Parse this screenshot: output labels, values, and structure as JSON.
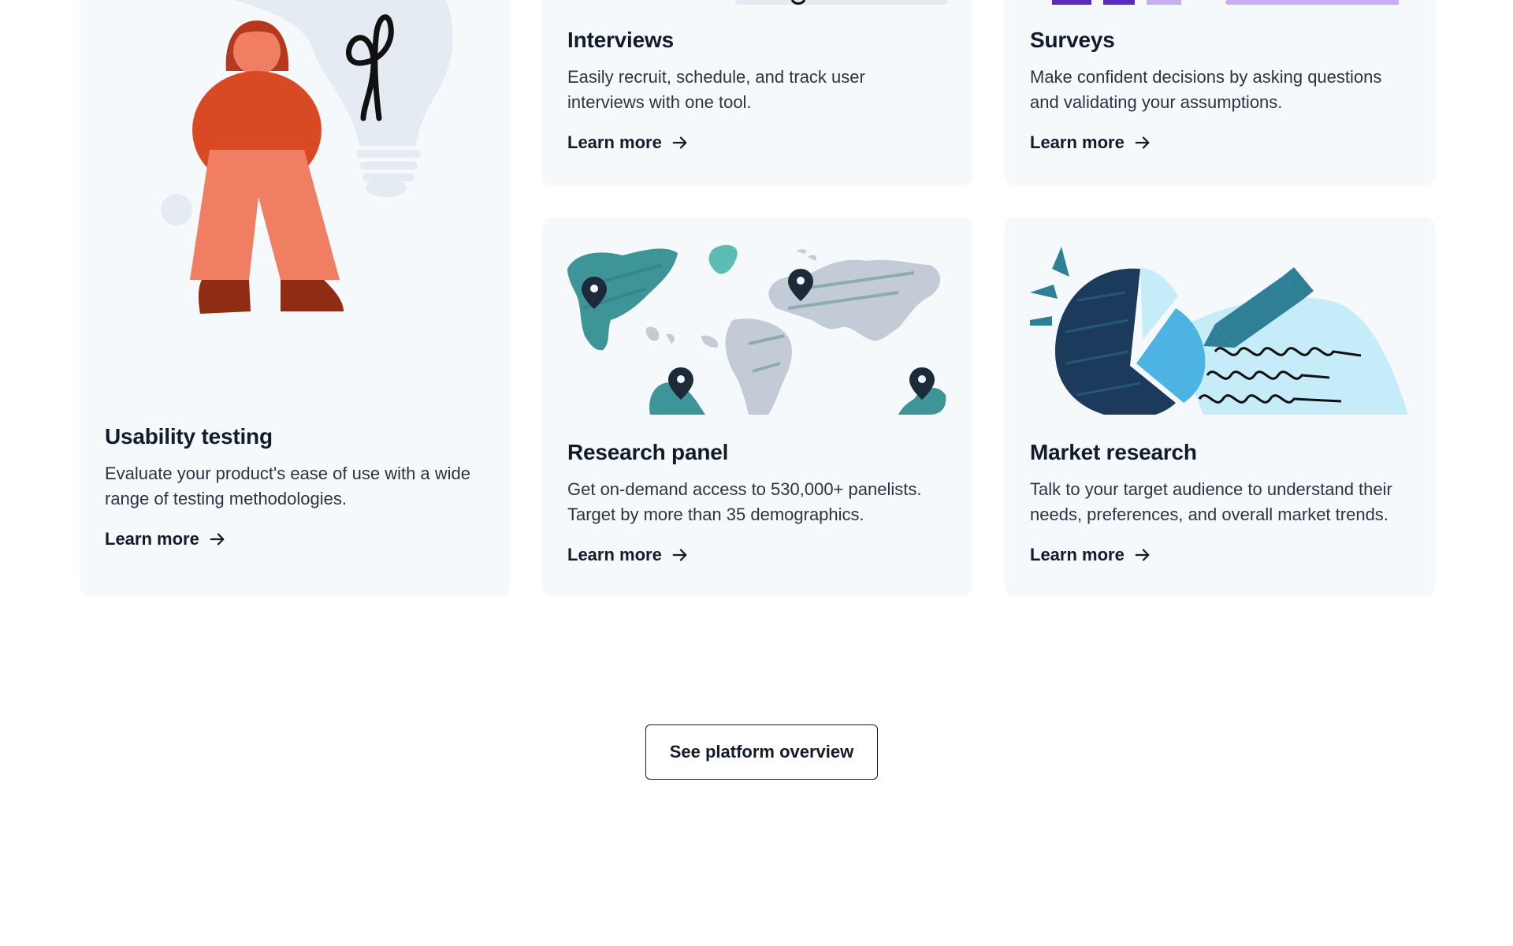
{
  "cards": {
    "usability": {
      "title": "Usability testing",
      "description": "Evaluate your product's ease of use with a wide range of testing methodologies.",
      "link": "Learn more",
      "illustration": "person-with-lightbulb-illustration"
    },
    "interviews": {
      "title": "Interviews",
      "description": "Easily recruit, schedule, and track user interviews with one tool.",
      "link": "Learn more"
    },
    "surveys": {
      "title": "Surveys",
      "description": "Make confident decisions by asking questions and validating your assumptions.",
      "link": "Learn more"
    },
    "panel": {
      "title": "Research panel",
      "description": "Get on-demand access to 530,000+ panelists. Target by more than 35 demographics.",
      "link": "Learn more",
      "illustration": "world-map-pins-illustration"
    },
    "market": {
      "title": "Market research",
      "description": "Talk to your target audience to understand their needs, preferences, and overall market trends.",
      "link": "Learn more",
      "illustration": "pie-chart-pencil-illustration"
    }
  },
  "cta": {
    "label": "See platform overview"
  },
  "colors": {
    "card_bg": "#f6f9fc",
    "text": "#111c2b",
    "orange": "#d94a24",
    "salmon": "#ef7e62",
    "teal": "#3e9597",
    "map_gray": "#c3ccd6",
    "navy": "#1c3a5c",
    "sky": "#4db3e3",
    "light_sky": "#c6ecfa",
    "purple": "#5b2bbd",
    "lavender": "#c5aef2"
  }
}
